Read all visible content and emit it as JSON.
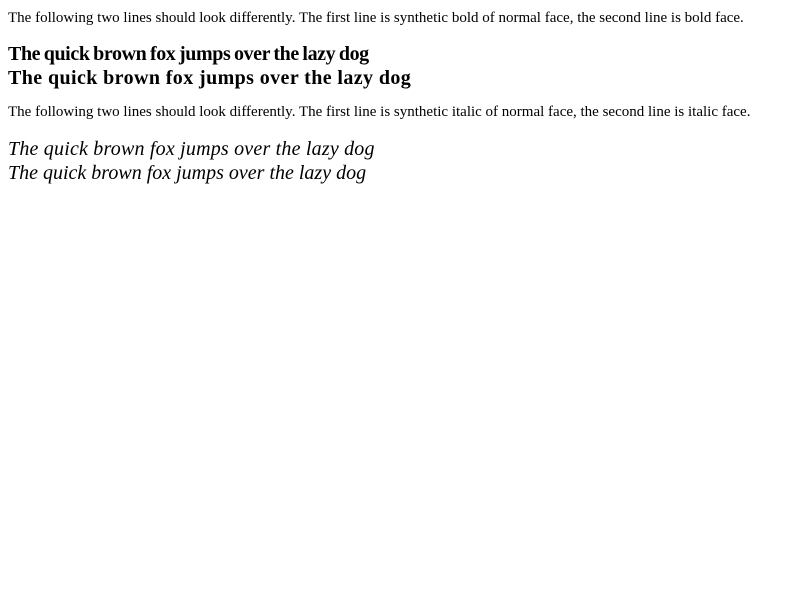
{
  "bold_test": {
    "note": "The following two lines should look differently. The first line is synthetic bold of normal face, the second line is bold face.",
    "synthetic_line": "The quick brown fox jumps over the lazy dog",
    "real_line": "The quick brown fox jumps over the lazy dog"
  },
  "italic_test": {
    "note": "The following two lines should look differently. The first line is synthetic italic of normal face, the second line is italic face.",
    "synthetic_line": "The quick brown fox jumps over the lazy dog",
    "real_line": "The quick brown fox jumps over the lazy dog"
  }
}
